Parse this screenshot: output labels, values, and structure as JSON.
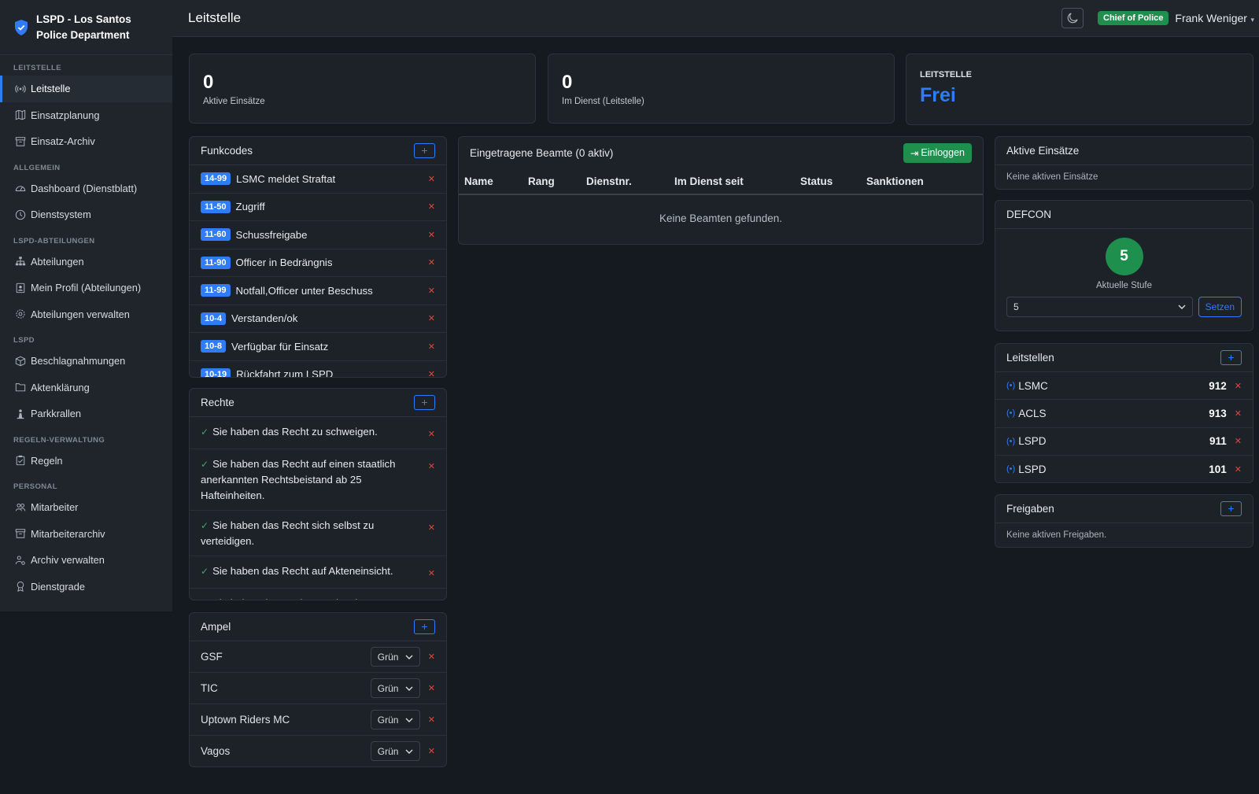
{
  "brand": {
    "title": "LSPD - Los Santos Police Department"
  },
  "sidebar": {
    "sections": [
      {
        "title": "LEITSTELLE",
        "items": [
          {
            "label": "Leitstelle",
            "icon": "broadcast-icon",
            "active": true
          },
          {
            "label": "Einsatzplanung",
            "icon": "map-icon"
          },
          {
            "label": "Einsatz-Archiv",
            "icon": "archive-icon"
          }
        ]
      },
      {
        "title": "ALLGEMEIN",
        "items": [
          {
            "label": "Dashboard (Dienstblatt)",
            "icon": "speedometer-icon"
          },
          {
            "label": "Dienstsystem",
            "icon": "clock-icon"
          }
        ]
      },
      {
        "title": "LSPD-ABTEILUNGEN",
        "items": [
          {
            "label": "Abteilungen",
            "icon": "sitemap-icon"
          },
          {
            "label": "Mein Profil (Abteilungen)",
            "icon": "profile-icon"
          },
          {
            "label": "Abteilungen verwalten",
            "icon": "gear-icon"
          }
        ]
      },
      {
        "title": "LSPD",
        "items": [
          {
            "label": "Beschlagnahmungen",
            "icon": "box-icon"
          },
          {
            "label": "Aktenklärung",
            "icon": "folder-icon"
          },
          {
            "label": "Parkkrallen",
            "icon": "person-icon"
          }
        ]
      },
      {
        "title": "REGELN-VERWALTUNG",
        "items": [
          {
            "label": "Regeln",
            "icon": "clipboard-icon"
          }
        ]
      },
      {
        "title": "PERSONAL",
        "items": [
          {
            "label": "Mitarbeiter",
            "icon": "people-icon"
          },
          {
            "label": "Mitarbeiterarchiv",
            "icon": "archive-icon"
          },
          {
            "label": "Archiv verwalten",
            "icon": "person-gear-icon"
          },
          {
            "label": "Dienstgrade",
            "icon": "award-icon"
          }
        ]
      }
    ]
  },
  "header": {
    "title": "Leitstelle",
    "role": "Chief of Police",
    "user": "Frank Weniger"
  },
  "stats": [
    {
      "value": "0",
      "label": "Aktive Einsätze"
    },
    {
      "value": "0",
      "label": "Im Dienst (Leitstelle)"
    }
  ],
  "leitstelle_status": {
    "label": "LEITSTELLE",
    "value": "Frei"
  },
  "funkcodes": {
    "title": "Funkcodes",
    "items": [
      {
        "code": "14-99",
        "text": "LSMC meldet Straftat"
      },
      {
        "code": "11-50",
        "text": "Zugriff"
      },
      {
        "code": "11-60",
        "text": "Schussfreigabe"
      },
      {
        "code": "11-90",
        "text": "Officer in Bedrängnis"
      },
      {
        "code": "11-99",
        "text": "Notfall,Officer unter Beschuss"
      },
      {
        "code": "10-4",
        "text": "Verstanden/ok"
      },
      {
        "code": "10-8",
        "text": "Verfügbar für Einsatz"
      },
      {
        "code": "10-19",
        "text": "Rückfahrt zum LSPD"
      }
    ]
  },
  "rechte": {
    "title": "Rechte",
    "items": [
      "Sie haben das Recht zu schweigen.",
      "Sie haben das Recht auf einen staatlich anerkannten Rechtsbeistand ab 25 Hafteinheiten.",
      "Sie haben das Recht sich selbst zu verteidigen.",
      "Sie haben das Recht auf Akteneinsicht.",
      "Sie haben das Recht zu schweigen"
    ]
  },
  "ampel": {
    "title": "Ampel",
    "items": [
      {
        "name": "GSF",
        "value": "Grün"
      },
      {
        "name": "TIC",
        "value": "Grün"
      },
      {
        "name": "Uptown Riders MC",
        "value": "Grün"
      },
      {
        "name": "Vagos",
        "value": "Grün"
      }
    ]
  },
  "beamte": {
    "title": "Eingetragene Beamte (0 aktiv)",
    "login_label": "Einloggen",
    "columns": [
      "Name",
      "Rang",
      "Dienstnr.",
      "Im Dienst seit",
      "Status",
      "Sanktionen"
    ],
    "empty": "Keine Beamten gefunden."
  },
  "aktive_einsaetze": {
    "title": "Aktive Einsätze",
    "empty": "Keine aktiven Einsätze"
  },
  "defcon": {
    "title": "DEFCON",
    "level": "5",
    "caption": "Aktuelle Stufe",
    "select_value": "5",
    "set_label": "Setzen"
  },
  "leitstellen": {
    "title": "Leitstellen",
    "items": [
      {
        "name": "LSMC",
        "number": "912"
      },
      {
        "name": "ACLS",
        "number": "913"
      },
      {
        "name": "LSPD",
        "number": "911"
      },
      {
        "name": "LSPD",
        "number": "101"
      }
    ]
  },
  "freigaben": {
    "title": "Freigaben",
    "empty": "Keine aktiven Freigaben."
  },
  "colors": {
    "accent": "#2f7cf6",
    "success": "#1f8f4e",
    "danger": "#e0463c",
    "defcon_green": "#1f8f4e"
  }
}
